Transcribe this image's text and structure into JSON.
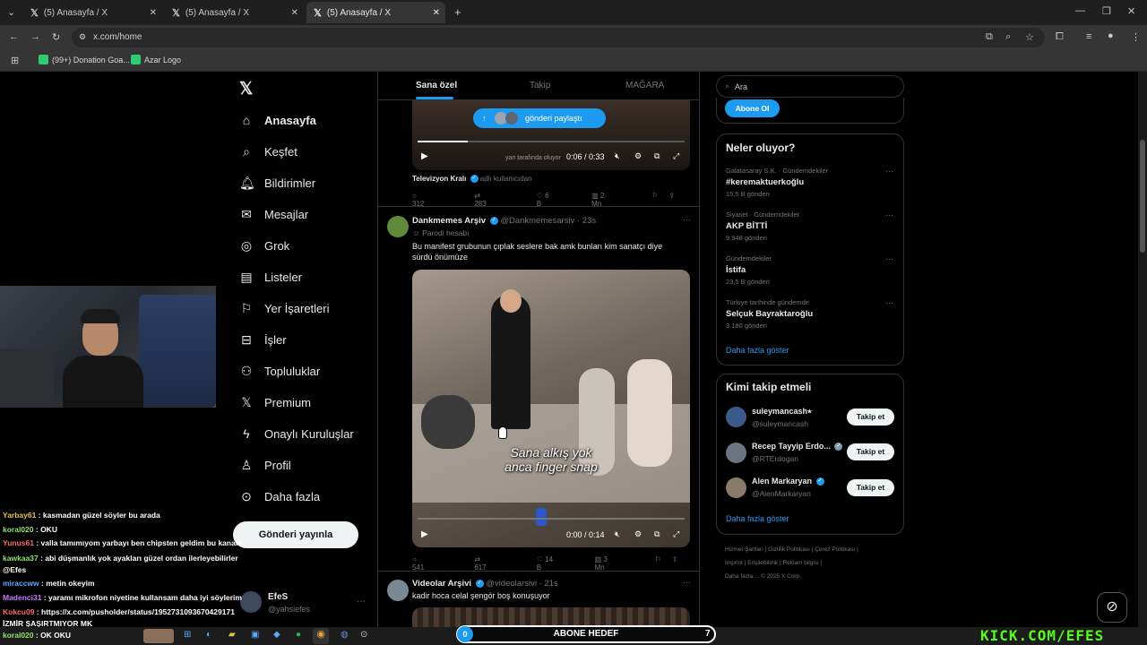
{
  "browser": {
    "tabs": [
      {
        "title": "(5) Anasayfa / X"
      },
      {
        "title": "(5) Anasayfa / X"
      },
      {
        "title": "(5) Anasayfa / X"
      }
    ],
    "url": "x.com/home",
    "bookmarks": [
      {
        "label": "(99+) Donation Goa..."
      },
      {
        "label": "Azar Logo"
      }
    ]
  },
  "nav": {
    "items": [
      {
        "label": "Anasayfa",
        "icon": "home-icon"
      },
      {
        "label": "Keşfet",
        "icon": "search-icon"
      },
      {
        "label": "Bildirimler",
        "icon": "bell-icon"
      },
      {
        "label": "Mesajlar",
        "icon": "mail-icon"
      },
      {
        "label": "Grok",
        "icon": "grok-icon"
      },
      {
        "label": "Listeler",
        "icon": "list-icon"
      },
      {
        "label": "Yer İşaretleri",
        "icon": "bookmark-icon"
      },
      {
        "label": "İşler",
        "icon": "briefcase-icon"
      },
      {
        "label": "Topluluklar",
        "icon": "people-icon"
      },
      {
        "label": "Premium",
        "icon": "x-icon"
      },
      {
        "label": "Onaylı Kuruluşlar",
        "icon": "lightning-icon"
      },
      {
        "label": "Profil",
        "icon": "user-icon"
      },
      {
        "label": "Daha fazla",
        "icon": "more-icon"
      }
    ],
    "post_button": "Gönderi yayınla",
    "account": {
      "name": "EfeS",
      "handle": "@yahsiefes"
    }
  },
  "feed": {
    "tabs": [
      "Sana özel",
      "Takip",
      "MAĞARA"
    ],
    "share_pill": "gönderi paylaştı",
    "post1": {
      "time": "0:06 / 0:33",
      "source": "Televizyon Kralı",
      "source_suffix": "adlı kullanıcıdan",
      "overlay_text": "yan tarafında oluyor",
      "replies": "312",
      "reposts": "283",
      "likes": "6 B",
      "views": "2 Mn"
    },
    "post2": {
      "author": "Dankmemes Arşiv",
      "handle": "@Dankmemesarsiv",
      "age": "23s",
      "badge": "Parodi hesabı",
      "text": "Bu manifest grubunun çıplak seslere bak amk bunları kim sanatçı diye sürdü önümüze",
      "caption_line1": "Sana alkış yok",
      "caption_line2": "anca finger snap",
      "time": "0:00 / 0:14",
      "replies": "541",
      "reposts": "617",
      "likes": "14 B",
      "views": "3 Mn"
    },
    "post3": {
      "author": "Videolar Arşivi",
      "handle": "@videolarsivi",
      "age": "21s",
      "text": "kadir hoca celal şengör boş konuşuyor"
    }
  },
  "sidebar": {
    "search_placeholder": "Ara",
    "subscribe_button": "Abone Ol",
    "trends_title": "Neler oluyor?",
    "trends": [
      {
        "context": "Galatasaray S.K. · Gündemdekiler",
        "title": "#keremaktuerkoğlu",
        "count": "15,5 B gönderi"
      },
      {
        "context": "Siyaset · Gündemdekiler",
        "title": "AKP BİTTİ",
        "count": "9.948 gönderi"
      },
      {
        "context": "Gündemdekiler",
        "title": "İstifa",
        "count": "23,5 B gönderi"
      },
      {
        "context": "Türkiye tarihinde gündemde",
        "title": "Selçuk Bayraktaroğlu",
        "count": "3.180 gönderi"
      }
    ],
    "trends_more": "Daha fazla göster",
    "follow_title": "Kimi takip etmeli",
    "follow": [
      {
        "name": "suleymancash⭑",
        "handle": "@suleymancash",
        "button": "Takip et"
      },
      {
        "name": "Recep Tayyip Erdo...",
        "handle": "@RTErdogan",
        "button": "Takip et"
      },
      {
        "name": "Alen Markaryan",
        "handle": "@AlenMarkaryan",
        "button": "Takip et"
      }
    ],
    "follow_more": "Daha fazla göster",
    "footer_links": [
      "Hizmet Şartları",
      "Gizlilik Politikası",
      "Çerez Politikası",
      "Imprint",
      "Erişilebilirlik",
      "Reklam bilgisi",
      "Daha fazla ...",
      "© 2025 X Corp."
    ]
  },
  "chat": [
    {
      "user": "Yarbay61",
      "msg": "kasmadan güzel söyler bu arada",
      "color": "#e3c04a"
    },
    {
      "user": "koral020",
      "msg": "OKU",
      "color": "#8fe36b"
    },
    {
      "user": "Yunus61",
      "msg": "valla tamımıyom yarbayı ben chipsten geldim bu kanala",
      "color": "#ff6b6b"
    },
    {
      "user": "kawkaa37",
      "msg": "abi düşmanlık yok ayakları güzel ordan ilerleyebilirler @Efes",
      "color": "#8fe36b"
    },
    {
      "user": "miraccww",
      "msg": "metin okeyim",
      "color": "#5aa9ff"
    },
    {
      "user": "Madenci31",
      "msg": "yaramı mikrofon niyetine kullansam daha iyi söylerim",
      "color": "#c77dff"
    },
    {
      "user": "Kokcu09",
      "msg": "https://x.com/pusholder/status/1952731093670429171 İZMİR ŞAŞIRTMIYOR MK",
      "color": "#ff6b6b"
    },
    {
      "user": "koral020",
      "msg": "OK OKU",
      "color": "#8fe36b"
    }
  ],
  "goal_bar": {
    "start": "0",
    "label": "ABONE HEDEF",
    "end": "7"
  },
  "watermark": "KICK.COM/EFES"
}
